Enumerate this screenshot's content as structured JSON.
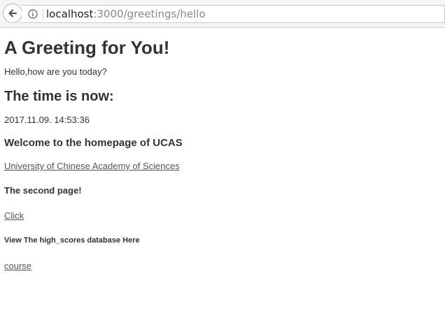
{
  "browser": {
    "url_host": "localhost",
    "url_path": ":3000/greetings/hello"
  },
  "page": {
    "heading": "A Greeting for You!",
    "greeting_text": "Hello,how are you today?",
    "time_heading": "The time is now:",
    "time_value": "2017.11.09. 14:53:36",
    "welcome_heading": "Welcome to the homepage of UCAS",
    "ucas_link": "University of Chinese Academy of Sciences",
    "second_page_heading": "The second page!",
    "click_link": "Click",
    "database_heading": "View The high_scores database Here",
    "course_link": "course"
  },
  "icons": {
    "back": "back-arrow-icon",
    "info": "info-icon"
  },
  "colors": {
    "link": "#555555",
    "text": "#333333",
    "url_path": "#8a8a8a"
  }
}
